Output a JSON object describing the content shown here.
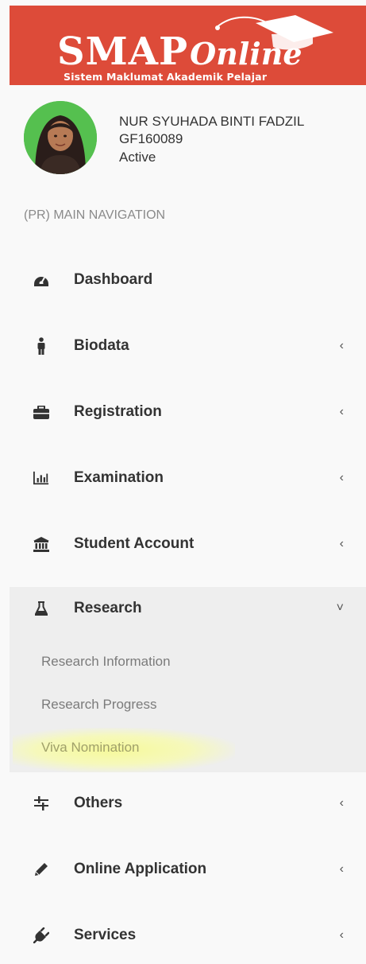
{
  "logo": {
    "title_main": "SMAP",
    "title_script": "Online",
    "subtitle": "Sistem Maklumat Akademik Pelajar",
    "background": "#dd4b39",
    "icon": "graduation-cap-icon"
  },
  "user": {
    "name": "NUR SYUHADA BINTI FADZIL",
    "id": "GF160089",
    "status": "Active",
    "avatar_icon": "user-avatar"
  },
  "nav": {
    "header": "(PR) MAIN NAVIGATION",
    "items": [
      {
        "label": "Dashboard",
        "icon": "dashboard-icon",
        "chevron": ""
      },
      {
        "label": "Biodata",
        "icon": "male-icon",
        "chevron": "‹"
      },
      {
        "label": "Registration",
        "icon": "briefcase-icon",
        "chevron": "‹"
      },
      {
        "label": "Examination",
        "icon": "bar-chart-icon",
        "chevron": "‹"
      },
      {
        "label": "Student Account",
        "icon": "bank-icon",
        "chevron": "‹"
      },
      {
        "label": "Research",
        "icon": "flask-icon",
        "chevron": "˅"
      },
      {
        "label": "Others",
        "icon": "sliders-icon",
        "chevron": "‹"
      },
      {
        "label": "Online Application",
        "icon": "pencil-icon",
        "chevron": "‹"
      },
      {
        "label": "Services",
        "icon": "plug-icon",
        "chevron": "‹"
      }
    ],
    "research_sub": [
      {
        "label": "Research Information"
      },
      {
        "label": "Research Progress"
      },
      {
        "label": "Viva Nomination",
        "highlighted": true
      }
    ]
  }
}
